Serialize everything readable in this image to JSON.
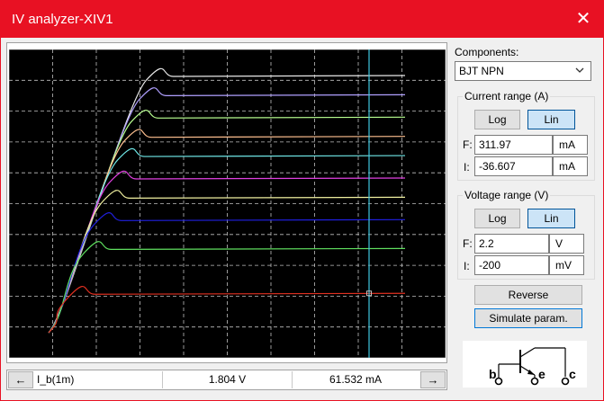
{
  "window": {
    "title": "IV analyzer-XIV1",
    "close_glyph": "✕"
  },
  "plot": {
    "background": "#000000",
    "grid_color": "#c0c0c0",
    "cursor_color": "#40c8e0",
    "curves": [
      {
        "color": "#e8e8e8",
        "saturation_current_fraction": 0.8
      },
      {
        "color": "#b0a0ff",
        "saturation_current_fraction": 0.74
      },
      {
        "color": "#b8ff90",
        "saturation_current_fraction": 0.67
      },
      {
        "color": "#ffc090",
        "saturation_current_fraction": 0.61
      },
      {
        "color": "#70e8e8",
        "saturation_current_fraction": 0.55
      },
      {
        "color": "#e040e0",
        "saturation_current_fraction": 0.48
      },
      {
        "color": "#f0f0a0",
        "saturation_current_fraction": 0.42
      },
      {
        "color": "#2020e0",
        "saturation_current_fraction": 0.35
      },
      {
        "color": "#60e060",
        "saturation_current_fraction": 0.26
      },
      {
        "color": "#e03020",
        "saturation_current_fraction": 0.12
      }
    ]
  },
  "status": {
    "left_arrow": "←",
    "right_arrow": "→",
    "curve_label": "I_b(1m)",
    "voltage": "1.804  V",
    "current": "61.532 mA"
  },
  "components": {
    "label": "Components:",
    "selected": "BJT NPN"
  },
  "current_range": {
    "title": "Current range (A)",
    "log_label": "Log",
    "lin_label": "Lin",
    "f_label": "F:",
    "f_value": "311.97",
    "f_unit": "mA",
    "i_label": "I:",
    "i_value": "-36.607",
    "i_unit": "mA"
  },
  "voltage_range": {
    "title": "Voltage range (V)",
    "log_label": "Log",
    "lin_label": "Lin",
    "f_label": "F:",
    "f_value": "2.2",
    "f_unit": "V",
    "i_label": "I:",
    "i_value": "-200",
    "i_unit": "mV"
  },
  "buttons": {
    "reverse": "Reverse",
    "simulate": "Simulate param."
  },
  "schematic": {
    "b": "b",
    "e": "e",
    "c": "c"
  }
}
